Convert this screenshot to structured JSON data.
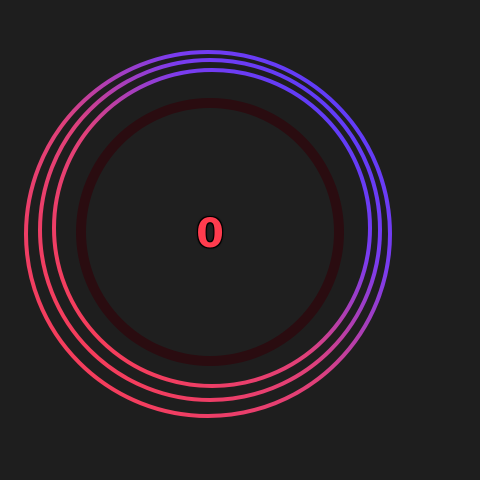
{
  "counter": {
    "value": "0"
  },
  "colors": {
    "background": "#1e1e1e",
    "ring_start": "#5a45ff",
    "ring_end": "#ff3c4e",
    "inner_fill": "#1f1f1f",
    "inner_band": "#2a0c10",
    "counter_text": "#ff3c4e"
  }
}
